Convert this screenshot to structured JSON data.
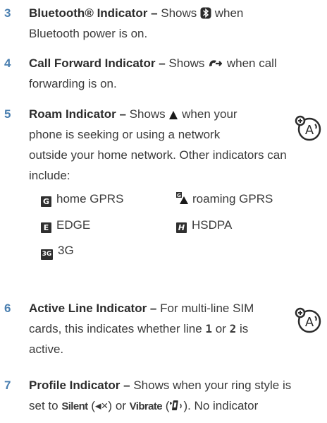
{
  "items": [
    {
      "number": "3",
      "title": "Bluetooth® Indicator –",
      "text_before_icon": " Shows ",
      "icon": "bluetooth-icon",
      "text_after_icon": " when",
      "line2": "Bluetooth power is on."
    },
    {
      "number": "4",
      "title": "Call Forward Indicator –",
      "text_before_icon": " Shows ",
      "icon": "call-forward-icon",
      "text_after_icon": " when call",
      "line2": "forwarding is on."
    },
    {
      "number": "5",
      "title": "Roam Indicator –",
      "text_before_icon": " Shows ",
      "icon": "roam-triangle-icon",
      "text_after_icon": " when your",
      "line2": "phone is seeking or using a network",
      "line3": "outside your home network. Other indicators can",
      "line4": "include:",
      "indicators": [
        {
          "glyph": "G",
          "label": "home GPRS",
          "icon": "gprs-home-icon"
        },
        {
          "glyph": "G▲",
          "label": "roaming GPRS",
          "icon": "gprs-roaming-icon"
        },
        {
          "glyph": "E",
          "label": "EDGE",
          "icon": "edge-icon"
        },
        {
          "glyph": "H",
          "label": "HSDPA",
          "icon": "hsdpa-icon"
        },
        {
          "glyph": "3G",
          "label": "3G",
          "icon": "3g-icon"
        }
      ]
    },
    {
      "number": "6",
      "title": "Active Line Indicator –",
      "text_1": " For multi-line SIM",
      "line2_a": "cards, this indicates whether line ",
      "line2_b": "1",
      "line2_c": " or ",
      "line2_d": "2",
      "line2_e": " is",
      "line3": "active."
    },
    {
      "number": "7",
      "title": "Profile Indicator –",
      "text_1": " Shows when your ring style is",
      "line2_a": "set to ",
      "silent": "Silent",
      "silent_icon": "(◂×)",
      "line2_b": " or ",
      "vibrate": "Vibrate",
      "vibrate_icon": "(",
      "line2_c": "). No indicator"
    }
  ],
  "colors": {
    "number": "#4a7fb0",
    "text": "#3a3a3a"
  }
}
